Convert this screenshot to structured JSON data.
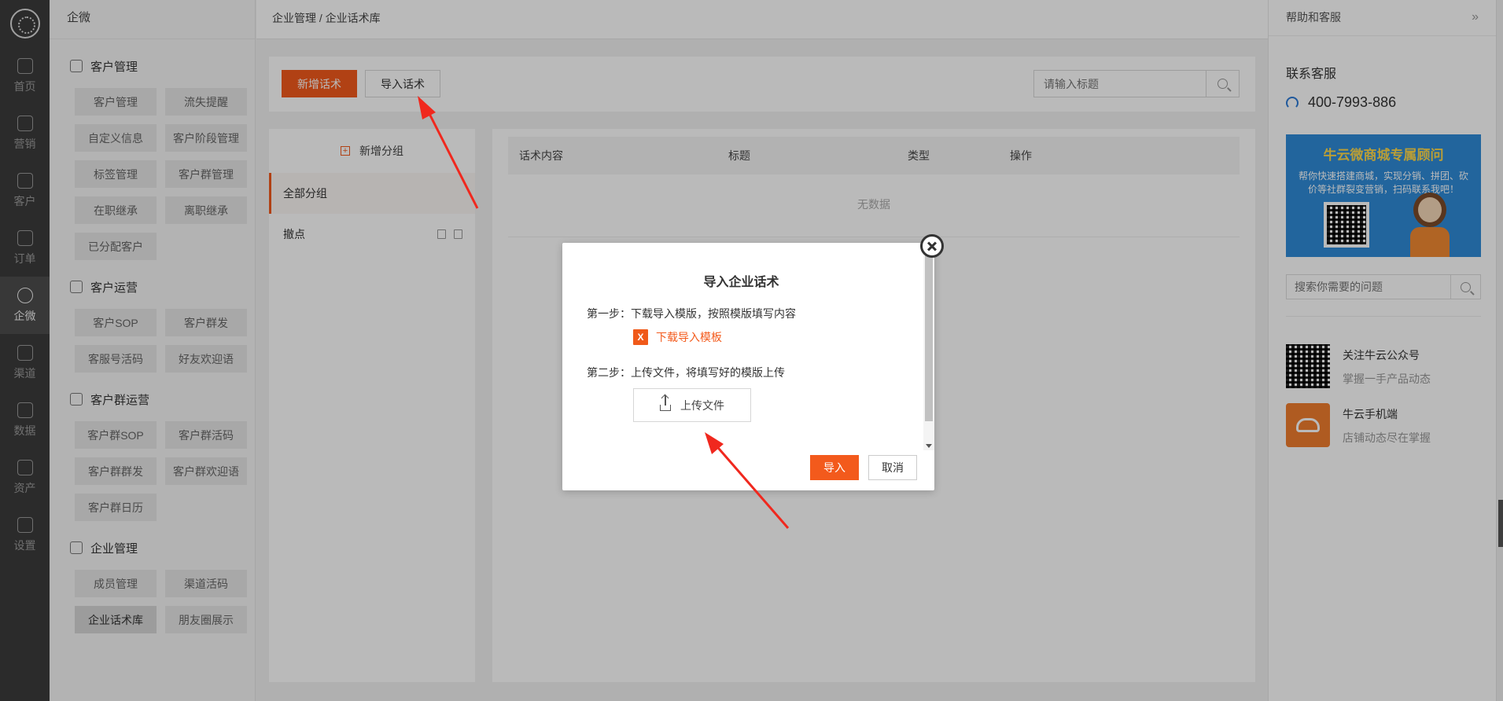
{
  "rail": {
    "items": [
      {
        "label": "首页",
        "icon": "home-icon"
      },
      {
        "label": "营销",
        "icon": "marketing-icon"
      },
      {
        "label": "客户",
        "icon": "user-icon"
      },
      {
        "label": "订单",
        "icon": "order-icon"
      },
      {
        "label": "企微",
        "icon": "chat-icon",
        "active": true
      },
      {
        "label": "渠道",
        "icon": "channel-icon"
      },
      {
        "label": "数据",
        "icon": "chart-icon"
      },
      {
        "label": "资产",
        "icon": "asset-icon"
      },
      {
        "label": "设置",
        "icon": "gear-icon"
      }
    ]
  },
  "subnav": {
    "title": "企微",
    "sections": [
      {
        "title": "客户管理",
        "items": [
          "客户管理",
          "流失提醒",
          "自定义信息",
          "客户阶段管理",
          "标签管理",
          "客户群管理",
          "在职继承",
          "离职继承",
          "已分配客户"
        ]
      },
      {
        "title": "客户运营",
        "items": [
          "客户SOP",
          "客户群发",
          "客服号活码",
          "好友欢迎语"
        ]
      },
      {
        "title": "客户群运营",
        "items": [
          "客户群SOP",
          "客户群活码",
          "客户群群发",
          "客户群欢迎语",
          "客户群日历"
        ]
      },
      {
        "title": "企业管理",
        "items": [
          "成员管理",
          "渠道活码",
          "企业话术库",
          "朋友圈展示"
        ]
      }
    ],
    "active_item": "企业话术库"
  },
  "breadcrumb": "企业管理 / 企业话术库",
  "toolbar": {
    "new_label": "新增话术",
    "import_label": "导入话术",
    "search_placeholder": "请输入标题"
  },
  "groups": {
    "add_label": "新增分组",
    "items": [
      "全部分组",
      "撤点"
    ]
  },
  "table": {
    "columns": [
      "话术内容",
      "标题",
      "类型",
      "操作"
    ],
    "empty_text": "无数据"
  },
  "right_panel": {
    "header": "帮助和客服",
    "contact_title": "联系客服",
    "phone": "400-7993-886",
    "banner_title": "牛云微商城专属顾问",
    "banner_text": "帮你快速搭建商城，实现分销、拼团、砍价等社群裂变营销，扫码联系我吧！",
    "search_placeholder": "搜索你需要的问题",
    "links": [
      {
        "title": "关注牛云公众号",
        "subtitle": "掌握一手产品动态"
      },
      {
        "title": "牛云手机端",
        "subtitle": "店铺动态尽在掌握"
      }
    ]
  },
  "modal": {
    "title": "导入企业话术",
    "step1": "第一步：下载导入模版，按照模版填写内容",
    "download_label": "下载导入模板",
    "step2": "第二步：上传文件，将填写好的模版上传",
    "upload_label": "上传文件",
    "ok_label": "导入",
    "cancel_label": "取消"
  },
  "colors": {
    "accent": "#f35a1c",
    "rail_bg": "#3c3c3c",
    "annotation_arrow": "#f0281e"
  }
}
